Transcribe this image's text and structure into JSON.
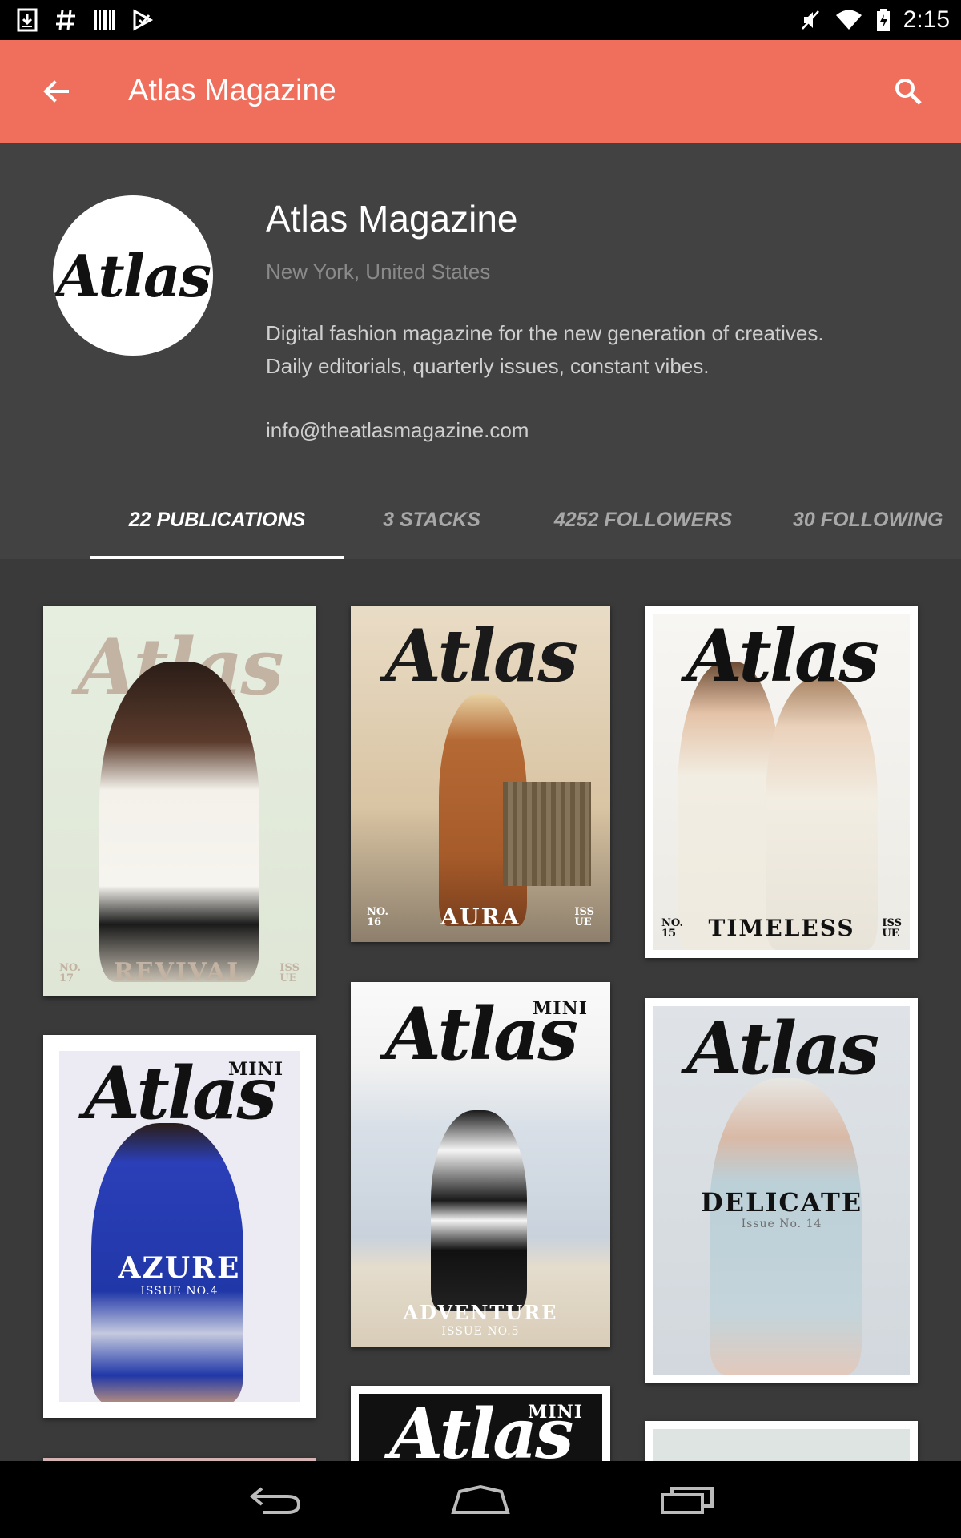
{
  "status_bar": {
    "time": "2:15",
    "left_icons": [
      "download-icon",
      "hash-icon",
      "barcode-icon",
      "play-store-icon"
    ],
    "right_icons": [
      "muted-icon",
      "wifi-icon",
      "battery-icon"
    ]
  },
  "app_bar": {
    "title": "Atlas Magazine",
    "back_icon": "arrow-left-icon",
    "search_icon": "search-icon",
    "color": "#f06e5c"
  },
  "profile": {
    "avatar_text": "Atlas",
    "name": "Atlas Magazine",
    "location": "New York, United States",
    "description_line1": "Digital fashion magazine for the new generation of creatives.",
    "description_line2": "Daily editorials, quarterly issues, constant vibes.",
    "email": "info@theatlasmagazine.com"
  },
  "tabs": [
    {
      "label": "22 PUBLICATIONS",
      "active": true
    },
    {
      "label": "3 STACKS",
      "active": false
    },
    {
      "label": "4252 FOLLOWERS",
      "active": false
    },
    {
      "label": "30 FOLLOWING",
      "active": false
    }
  ],
  "publications": [
    {
      "masthead": "Atlas",
      "title": "REVIVAL",
      "no_label": "NO.\n17",
      "issue_label": "ISS\nUE"
    },
    {
      "masthead": "Atlas",
      "title": "AURA",
      "no_label": "NO.\n16",
      "issue_label": "ISS\nUE"
    },
    {
      "masthead": "Atlas",
      "title": "TIMELESS",
      "no_label": "NO.\n15",
      "issue_label": "ISS\nUE"
    },
    {
      "masthead": "Atlas",
      "mini": "MINI",
      "title": "AZURE",
      "issue_no": "ISSUE NO.4"
    },
    {
      "masthead": "Atlas",
      "mini": "MINI",
      "title": "ADVENTURE",
      "issue_no": "ISSUE NO.5"
    },
    {
      "masthead": "Atlas",
      "title": "DELICATE",
      "issue_no": "Issue No. 14"
    },
    {
      "masthead": "Atlas",
      "mini": "MINI"
    }
  ],
  "nav_bar": {
    "back_icon": "nav-back-icon",
    "home_icon": "nav-home-icon",
    "recents_icon": "nav-recents-icon"
  }
}
